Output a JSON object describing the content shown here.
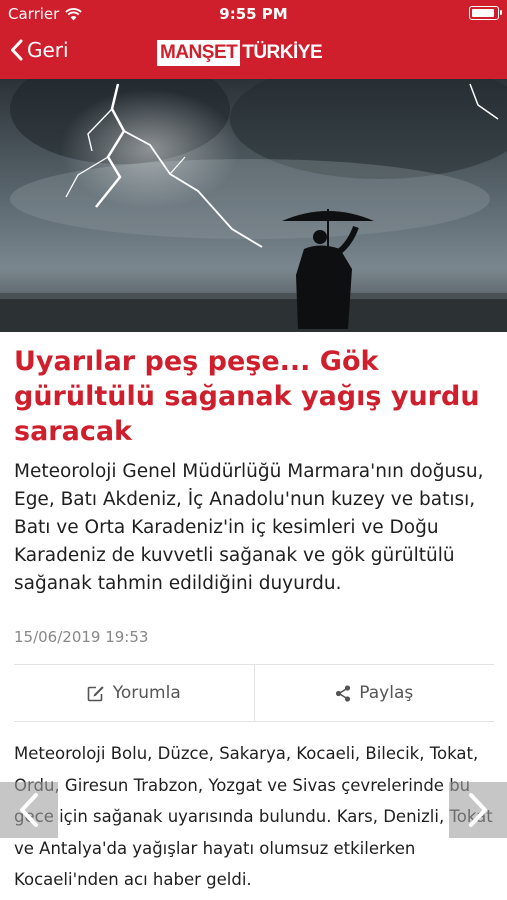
{
  "status_bar": {
    "carrier": "Carrier",
    "time": "9:55 PM",
    "battery_level": 0.92
  },
  "header": {
    "back_label": "Geri",
    "logo": {
      "part1": "MANŞET",
      "part2": "TÜRKİYE"
    },
    "accent_color": "#cf1f2d"
  },
  "article": {
    "headline": "Uyarılar peş peşe... Gök gürültülü sağanak yağış yurdu saracak",
    "summary": "Meteoroloji Genel Müdürlüğü Marmara'nın doğusu, Ege, Batı Akdeniz, İç Anadolu'nun kuzey ve batısı, Batı ve Orta Karadeniz'in iç kesimleri ve Doğu Karadeniz de kuvvetli sağanak ve gök gürültülü sağanak tahmin edildiğini duyurdu.",
    "timestamp": "15/06/2019 19:53",
    "body": "Meteoroloji Bolu, Düzce, Sakarya, Kocaeli, Bilecik, Tokat, Ordu, Giresun Trabzon, Yozgat ve Sivas çevrelerinde bu gece için sağanak uyarısında bulundu. Kars, Denizli, Tokat ve Antalya'da yağışlar hayatı olumsuz etkilerken Kocaeli'nden acı haber geldi."
  },
  "actions": {
    "comment_label": "Yorumla",
    "share_label": "Paylaş"
  },
  "icons": {
    "back": "chevron-left-icon",
    "comment": "edit-icon",
    "share": "share-icon",
    "prev": "chevron-left-icon",
    "next": "chevron-right-icon"
  }
}
